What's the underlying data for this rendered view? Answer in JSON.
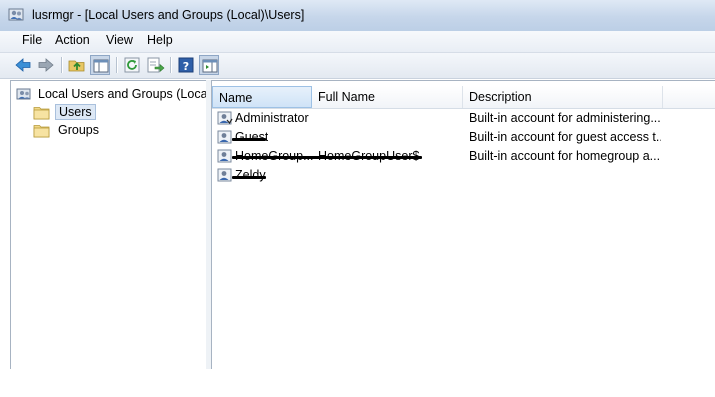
{
  "window": {
    "title": "lusrmgr - [Local Users and Groups (Local)\\Users]"
  },
  "menu": [
    "File",
    "Action",
    "View",
    "Help"
  ],
  "toolbar": {
    "buttons": [
      "back-icon",
      "forward-icon",
      "up-folder-icon",
      "show-hide-tree-icon",
      "refresh-icon",
      "export-list-icon",
      "help-icon",
      "show-hide-action-pane-icon"
    ]
  },
  "tree": {
    "root": "Local Users and Groups (Local)",
    "items": [
      {
        "label": "Users",
        "selected": true
      },
      {
        "label": "Groups",
        "selected": false
      }
    ]
  },
  "list": {
    "columns": [
      "Name",
      "Full Name",
      "Description"
    ],
    "sorted_column": "Name",
    "rows": [
      {
        "name": "Administrator",
        "full_name": "",
        "description": "Built-in account for administering...",
        "redacted": false
      },
      {
        "name": "Guest",
        "full_name": "",
        "description": "Built-in account for guest access t...",
        "redacted": true
      },
      {
        "name": "HomeGroup...",
        "full_name": "HomeGroupUser$",
        "description": "Built-in account for homegroup a...",
        "redacted": true
      },
      {
        "name": "Zeldy",
        "full_name": "",
        "description": "",
        "redacted": true
      }
    ]
  },
  "colors": {
    "titlebar": "#c6d6ea",
    "selection": "#dde8f5",
    "border": "#a7b3c2"
  }
}
